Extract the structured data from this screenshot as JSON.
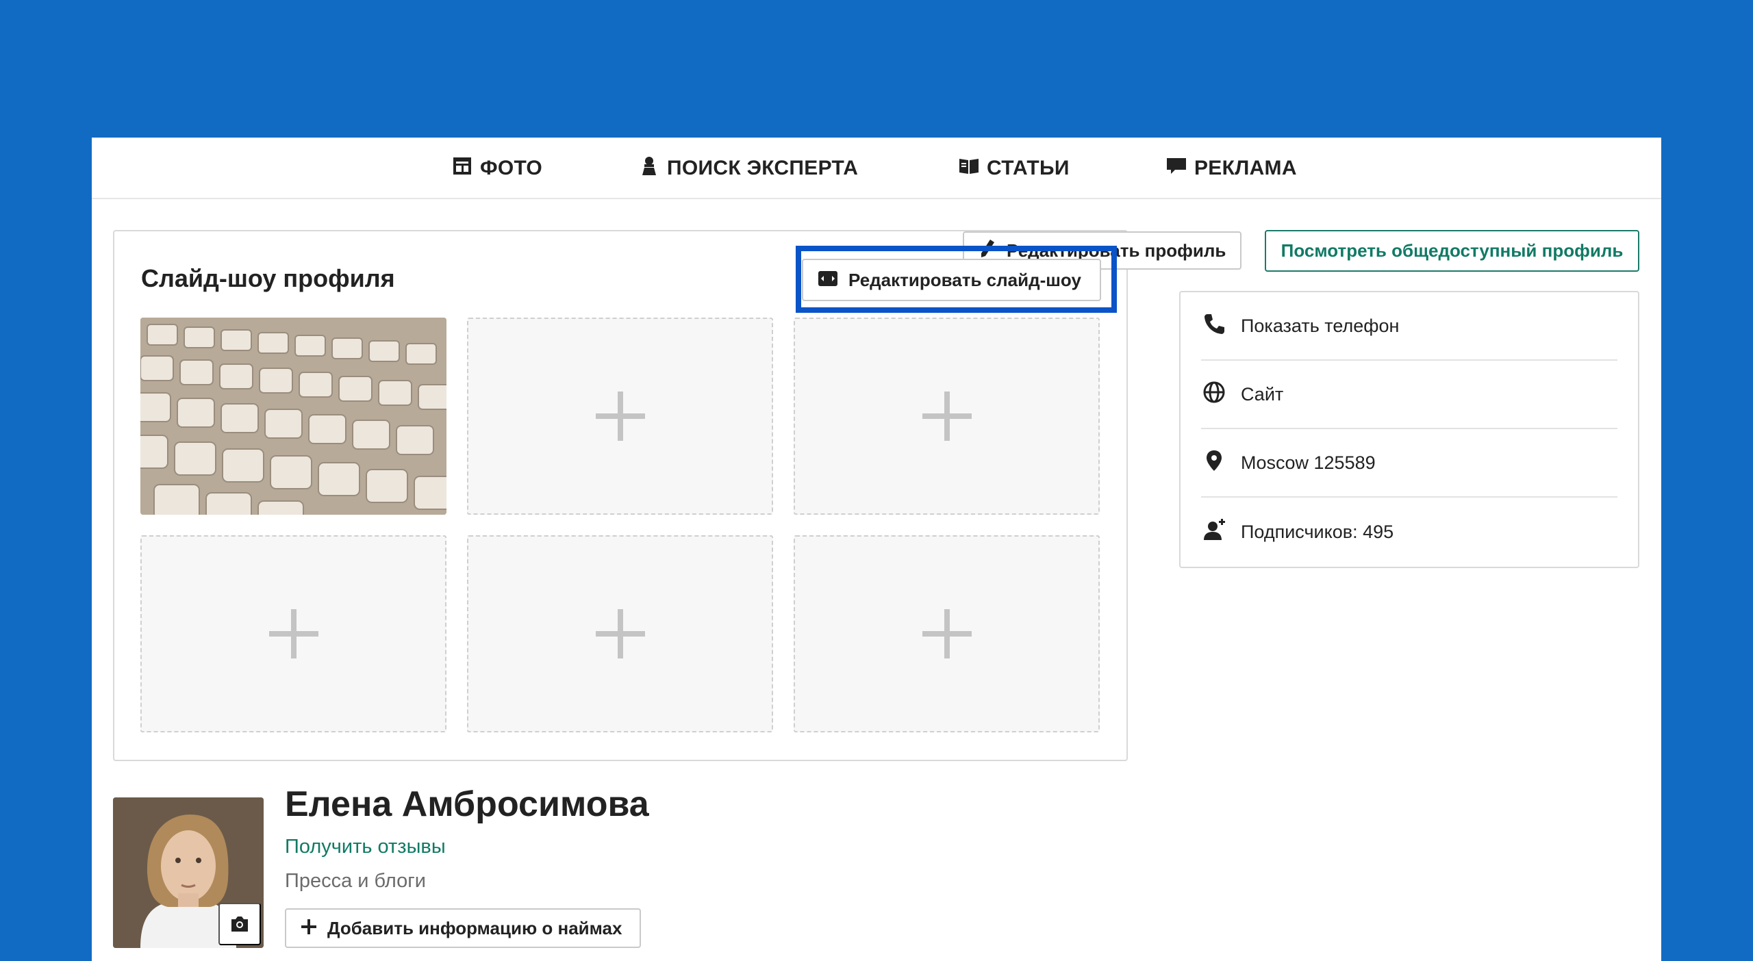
{
  "nav": {
    "photo": "ФОТО",
    "expert_search": "ПОИСК ЭКСПЕРТА",
    "articles": "СТАТЬИ",
    "ads": "РЕКЛАМА"
  },
  "actions": {
    "edit_profile": "Редактировать профиль",
    "view_public_profile": "Посмотреть общедоступный профиль"
  },
  "slideshow": {
    "title": "Слайд-шоу профиля",
    "edit_button": "Редактировать слайд-шоу",
    "tiles": [
      {
        "kind": "photo",
        "subject": "keyboard"
      },
      {
        "kind": "empty"
      },
      {
        "kind": "empty"
      },
      {
        "kind": "empty"
      },
      {
        "kind": "empty"
      },
      {
        "kind": "empty"
      }
    ]
  },
  "contacts": {
    "phone": "Показать телефон",
    "site": "Сайт",
    "location": "Moscow 125589",
    "followers": "Подписчиков: 495"
  },
  "profile": {
    "name": "Елена Амбросимова",
    "get_reviews": "Получить отзывы",
    "category": "Пресса и блоги",
    "add_hires": "Добавить информацию о наймах"
  },
  "colors": {
    "background": "#116bc3",
    "accent_green": "#117a65",
    "highlight_blue": "#0a54c8"
  },
  "icons": [
    "photo-album-icon",
    "expert-icon",
    "book-icon",
    "chat-icon",
    "pencil-icon",
    "slideshow-icon",
    "phone-icon",
    "globe-icon",
    "location-pin-icon",
    "followers-icon",
    "camera-icon",
    "plus-icon"
  ]
}
